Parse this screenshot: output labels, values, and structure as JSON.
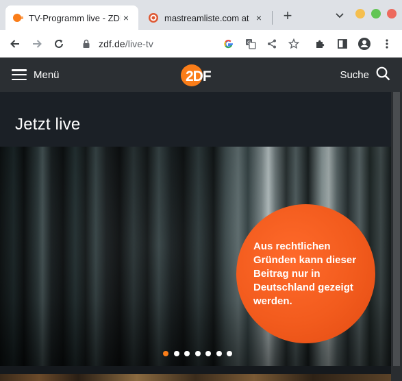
{
  "browser": {
    "tabs": [
      {
        "title": "TV-Programm live - ZDF",
        "favicon": "zdf-favicon",
        "active": true
      },
      {
        "title": "mastreamliste.com at",
        "favicon": "duckduckgo-favicon",
        "active": false
      }
    ],
    "new_tab_label": "+",
    "close_glyph": "×",
    "url_domain": "zdf.de",
    "url_path": "/live-tv",
    "colors": {
      "tabbar": "#dee1e6",
      "toolbar": "#ffffff",
      "win_min": "#f5bf4f",
      "win_max": "#61c554",
      "win_close": "#ed6a5e"
    }
  },
  "site": {
    "menu_label": "Menü",
    "logo_text": "2DF",
    "search_label": "Suche",
    "section_title": "Jetzt live",
    "geo_block_message": "Aus rechtlichen Gründen kann dieser Beitrag nur in Deutschland gezeigt werden.",
    "carousel": {
      "count": 7,
      "active_index": 0
    },
    "colors": {
      "brand_orange": "#fa7d19",
      "header_bg": "#2b2f33",
      "page_bg": "#1b2026"
    }
  }
}
